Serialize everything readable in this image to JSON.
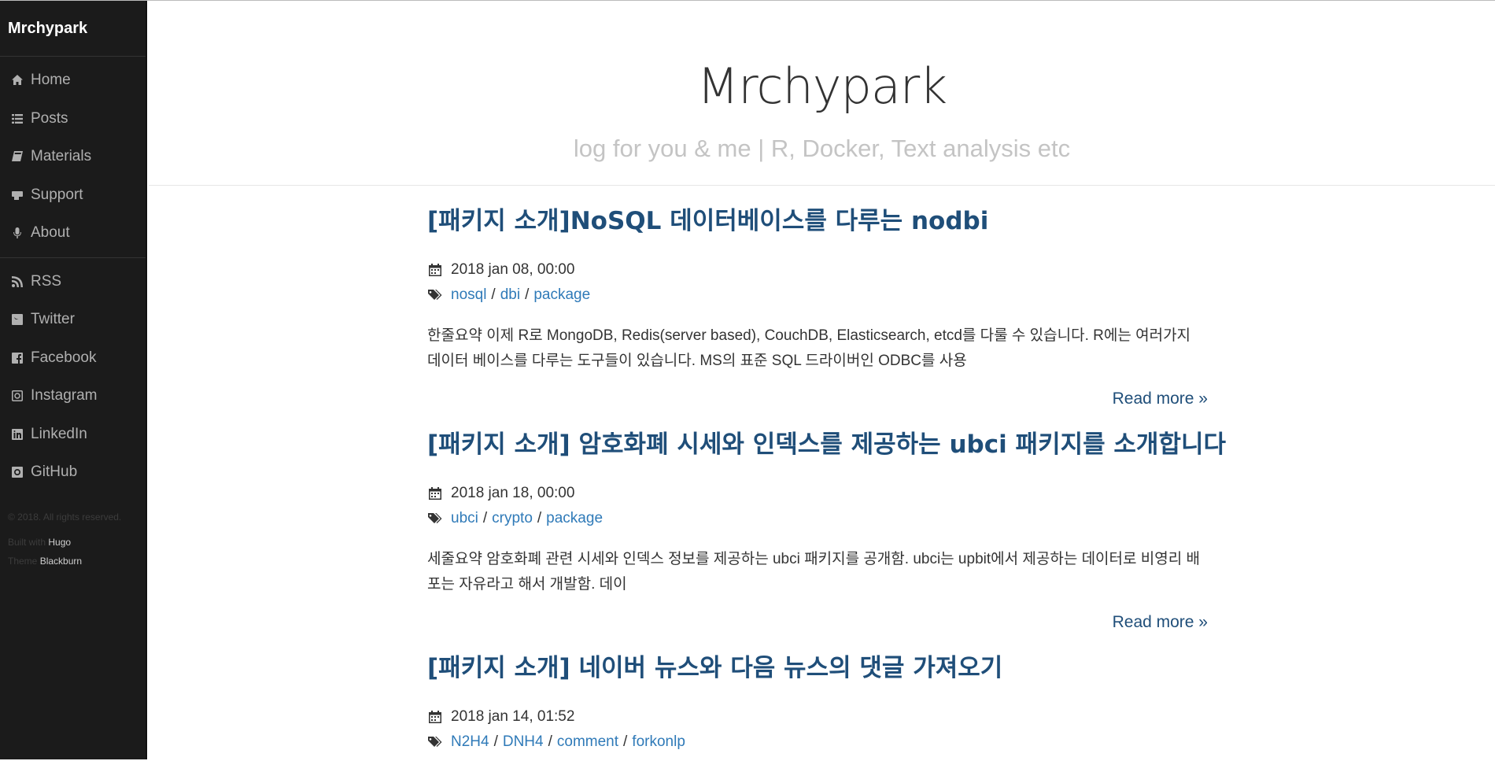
{
  "sidebar": {
    "brand": "Mrchypark",
    "nav": [
      {
        "label": "Home",
        "icon": "home-icon"
      },
      {
        "label": "Posts",
        "icon": "list-icon"
      },
      {
        "label": "Materials",
        "icon": "book-icon"
      },
      {
        "label": "Support",
        "icon": "money-icon"
      },
      {
        "label": "About",
        "icon": "microphone-icon"
      }
    ],
    "social": [
      {
        "label": "RSS",
        "icon": "rss-icon"
      },
      {
        "label": "Twitter",
        "icon": "twitter-icon"
      },
      {
        "label": "Facebook",
        "icon": "facebook-icon"
      },
      {
        "label": "Instagram",
        "icon": "instagram-icon"
      },
      {
        "label": "LinkedIn",
        "icon": "linkedin-icon"
      },
      {
        "label": "GitHub",
        "icon": "github-icon"
      }
    ],
    "footer": {
      "copyright": "© 2018. All rights reserved.",
      "built_with": "Built with",
      "hugo": "Hugo",
      "theme": "Theme",
      "blackburn": "Blackburn"
    }
  },
  "header": {
    "title": "Mrchypark",
    "subtitle": "log for you & me | R, Docker, Text analysis etc"
  },
  "posts": [
    {
      "title": "[패키지 소개]NoSQL 데이터베이스를 다루는 nodbi",
      "date": "2018 jan 08, 00:00",
      "tags": [
        "nosql",
        "dbi",
        "package"
      ],
      "summary": "한줄요약 이제 R로 MongoDB, Redis(server based), CouchDB, Elasticsearch, etcd를 다룰 수 있습니다. R에는 여러가지 데이터 베이스를 다루는 도구들이 있습니다. MS의 표준 SQL 드라이버인 ODBC를 사용",
      "read_more": "Read more »"
    },
    {
      "title": "[패키지 소개] 암호화폐 시세와 인덱스를 제공하는 ubci 패키지를 소개합니다",
      "date": "2018 jan 18, 00:00",
      "tags": [
        "ubci",
        "crypto",
        "package"
      ],
      "summary": "세줄요약 암호화폐 관련 시세와 인덱스 정보를 제공하는 ubci 패키지를 공개함. ubci는 upbit에서 제공하는 데이터로 비영리 배포는 자유라고 해서 개발함. 데이",
      "read_more": "Read more »"
    },
    {
      "title": "[패키지 소개] 네이버 뉴스와 다음 뉴스의 댓글 가져오기",
      "date": "2018 jan 14, 01:52",
      "tags": [
        "N2H4",
        "DNH4",
        "comment",
        "forkonlp"
      ]
    }
  ]
}
